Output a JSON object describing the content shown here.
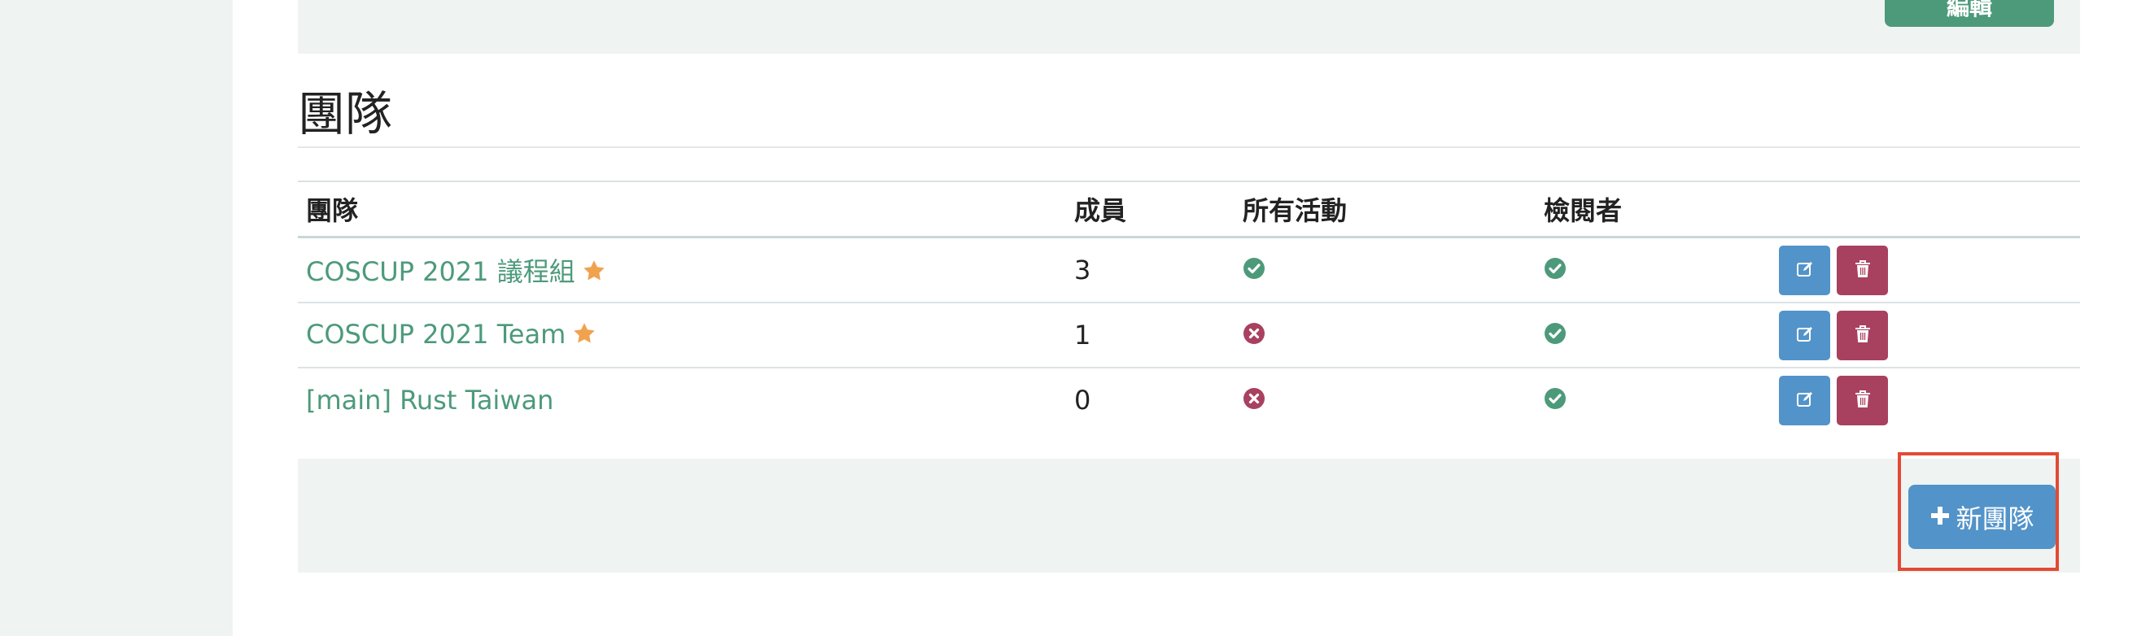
{
  "top_panel": {
    "button_label": "編輯"
  },
  "section": {
    "title": "團隊"
  },
  "table": {
    "headers": {
      "team": "團隊",
      "members": "成員",
      "all_events": "所有活動",
      "reviewer": "檢閱者",
      "actions": ""
    },
    "rows": [
      {
        "name": "COSCUP 2021 議程組",
        "starred": true,
        "members": "3",
        "all_events": "yes",
        "reviewer": "yes"
      },
      {
        "name": "COSCUP 2021 Team",
        "starred": true,
        "members": "1",
        "all_events": "no",
        "reviewer": "yes"
      },
      {
        "name": "[main] Rust Taiwan",
        "starred": false,
        "members": "0",
        "all_events": "no",
        "reviewer": "yes"
      }
    ]
  },
  "footer": {
    "new_team_label": "新團隊"
  },
  "colors": {
    "link": "#4d9a7b",
    "star": "#f0a24f",
    "check": "#4d9a7b",
    "cross": "#a8415f",
    "edit_button": "#5293c9",
    "delete_button": "#a8415f",
    "new_team_button": "#5293c9",
    "panel_bg": "#eff3f2",
    "highlight": "#e24a35"
  },
  "icons": {
    "star": "star-icon",
    "check": "check-circle-icon",
    "cross": "times-circle-icon",
    "edit": "edit-icon",
    "delete": "trash-icon",
    "add": "plus-icon"
  }
}
